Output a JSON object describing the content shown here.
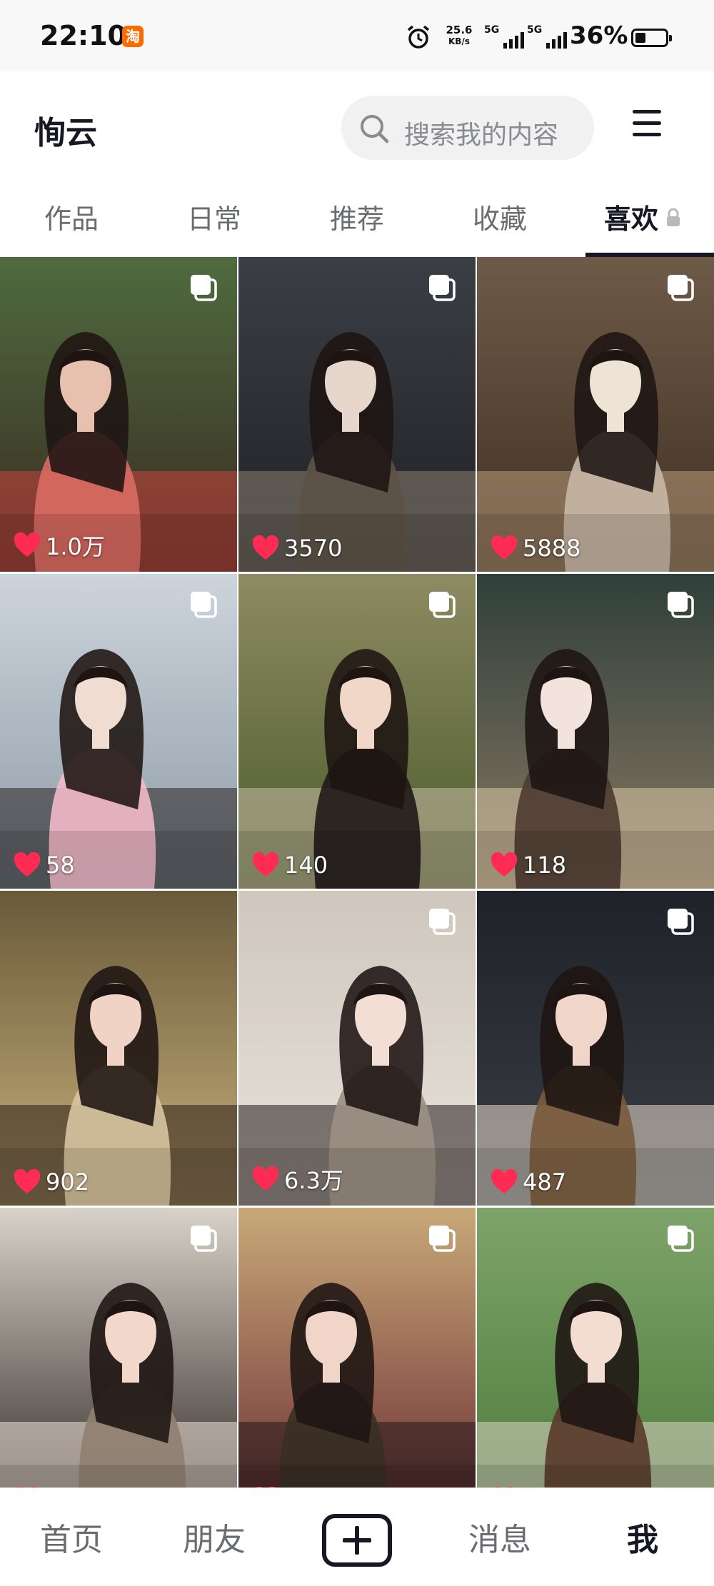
{
  "status_bar": {
    "time": "22:10",
    "app_badge": "淘",
    "net_speed_value": "25.6",
    "net_speed_unit": "KB/s",
    "sim1": "5G",
    "sim2": "5G",
    "battery_percent": "36%",
    "battery_level": 0.36
  },
  "header": {
    "username": "恂云",
    "search_placeholder": "搜索我的内容"
  },
  "tabs": [
    {
      "label": "作品"
    },
    {
      "label": "日常"
    },
    {
      "label": "推荐"
    },
    {
      "label": "收藏"
    },
    {
      "label": "喜欢",
      "active": true,
      "locked": true
    }
  ],
  "grid": [
    {
      "likes": "1.0万",
      "multi": true
    },
    {
      "likes": "3570",
      "multi": true
    },
    {
      "likes": "5888",
      "multi": true
    },
    {
      "likes": "58",
      "multi": true
    },
    {
      "likes": "140",
      "multi": true
    },
    {
      "likes": "118",
      "multi": true
    },
    {
      "likes": "902",
      "multi": false
    },
    {
      "likes": "6.3万",
      "multi": true
    },
    {
      "likes": "487",
      "multi": true
    },
    {
      "likes": "",
      "multi": true
    },
    {
      "likes": "",
      "multi": true
    },
    {
      "likes": "",
      "multi": true
    }
  ],
  "bottom_nav": {
    "home": "首页",
    "friends": "朋友",
    "messages": "消息",
    "me": "我"
  },
  "colors": {
    "heart": "#fe2c55",
    "text_primary": "#161823",
    "text_secondary": "#6b6c72",
    "badge": "#ff6a00"
  }
}
